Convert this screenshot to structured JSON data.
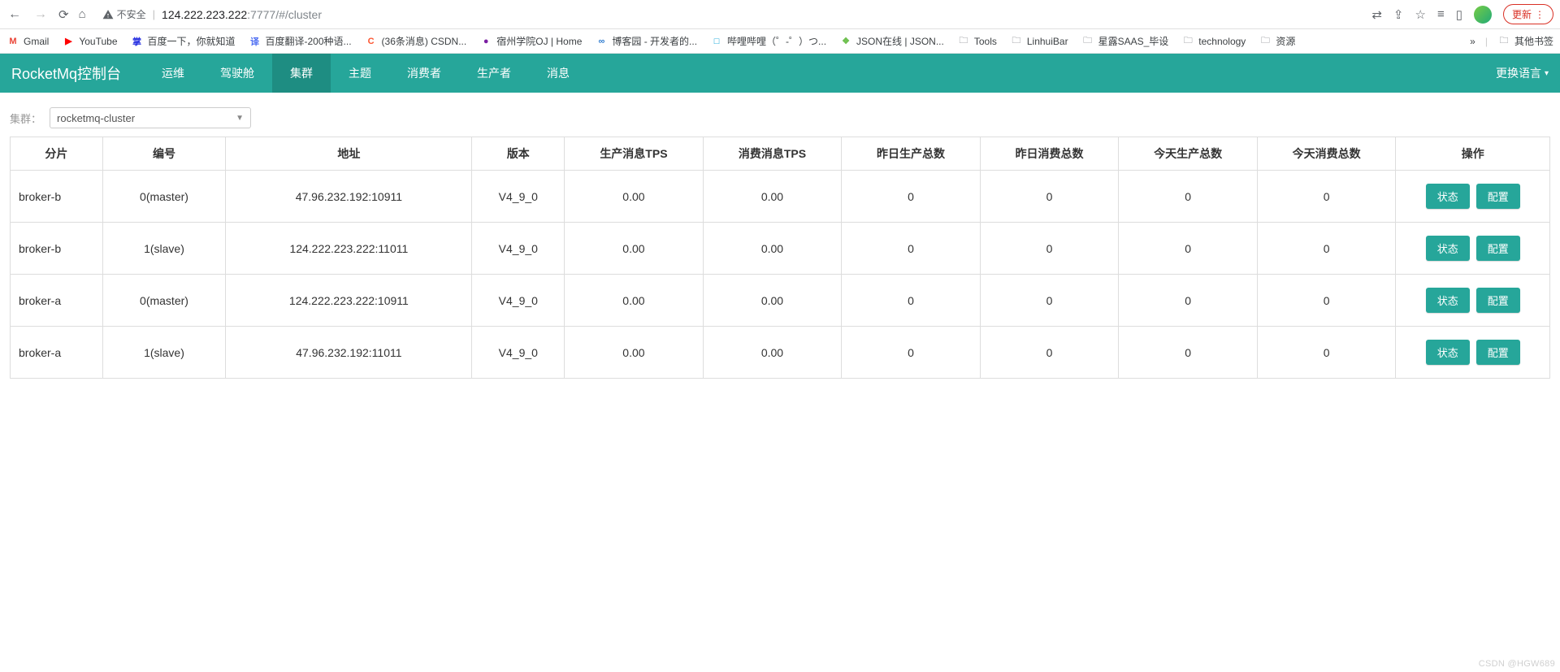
{
  "browser": {
    "insecure_label": "不安全",
    "url_host": "124.222.223.222",
    "url_port_path": ":7777/#/cluster",
    "update_label": "更新"
  },
  "bookmarks": {
    "items": [
      {
        "label": "Gmail",
        "favText": "M",
        "favColor": "#ea4335"
      },
      {
        "label": "YouTube",
        "favText": "▶",
        "favColor": "#ff0000"
      },
      {
        "label": "百度一下，你就知道",
        "favText": "掌",
        "favColor": "#2932e1"
      },
      {
        "label": "百度翻译-200种语...",
        "favText": "译",
        "favColor": "#4e6ef2"
      },
      {
        "label": "(36条消息) CSDN...",
        "favText": "C",
        "favColor": "#fc5531"
      },
      {
        "label": "宿州学院OJ | Home",
        "favText": "●",
        "favColor": "#7b1fa2"
      },
      {
        "label": "博客园 - 开发者的...",
        "favText": "∞",
        "favColor": "#2e7bcf"
      },
      {
        "label": "哔哩哔哩（゜-゜）つ...",
        "favText": "□",
        "favColor": "#00a1d6"
      },
      {
        "label": "JSON在线 | JSON...",
        "favText": "❖",
        "favColor": "#6ec04f"
      }
    ],
    "folders": [
      "Tools",
      "LinhuiBar",
      "星露SAAS_毕设",
      "technology",
      "资源"
    ],
    "more": "»",
    "other": "其他书签"
  },
  "nav": {
    "brand": "RocketMq控制台",
    "items": [
      "运维",
      "驾驶舱",
      "集群",
      "主题",
      "消费者",
      "生产者",
      "消息"
    ],
    "active_index": 2,
    "lang_label": "更换语言"
  },
  "filter": {
    "label": "集群：",
    "selected": "rocketmq-cluster"
  },
  "table": {
    "headers": [
      "分片",
      "编号",
      "地址",
      "版本",
      "生产消息TPS",
      "消费消息TPS",
      "昨日生产总数",
      "昨日消费总数",
      "今天生产总数",
      "今天消费总数",
      "操作"
    ],
    "status_btn": "状态",
    "config_btn": "配置",
    "rows": [
      {
        "shard": "broker-b",
        "id": "0(master)",
        "addr": "47.96.232.192:10911",
        "ver": "V4_9_0",
        "ptps": "0.00",
        "ctps": "0.00",
        "yp": "0",
        "yc": "0",
        "tp": "0",
        "tc": "0"
      },
      {
        "shard": "broker-b",
        "id": "1(slave)",
        "addr": "124.222.223.222:11011",
        "ver": "V4_9_0",
        "ptps": "0.00",
        "ctps": "0.00",
        "yp": "0",
        "yc": "0",
        "tp": "0",
        "tc": "0"
      },
      {
        "shard": "broker-a",
        "id": "0(master)",
        "addr": "124.222.223.222:10911",
        "ver": "V4_9_0",
        "ptps": "0.00",
        "ctps": "0.00",
        "yp": "0",
        "yc": "0",
        "tp": "0",
        "tc": "0"
      },
      {
        "shard": "broker-a",
        "id": "1(slave)",
        "addr": "47.96.232.192:11011",
        "ver": "V4_9_0",
        "ptps": "0.00",
        "ctps": "0.00",
        "yp": "0",
        "yc": "0",
        "tp": "0",
        "tc": "0"
      }
    ]
  },
  "watermark": "CSDN @HGW689"
}
